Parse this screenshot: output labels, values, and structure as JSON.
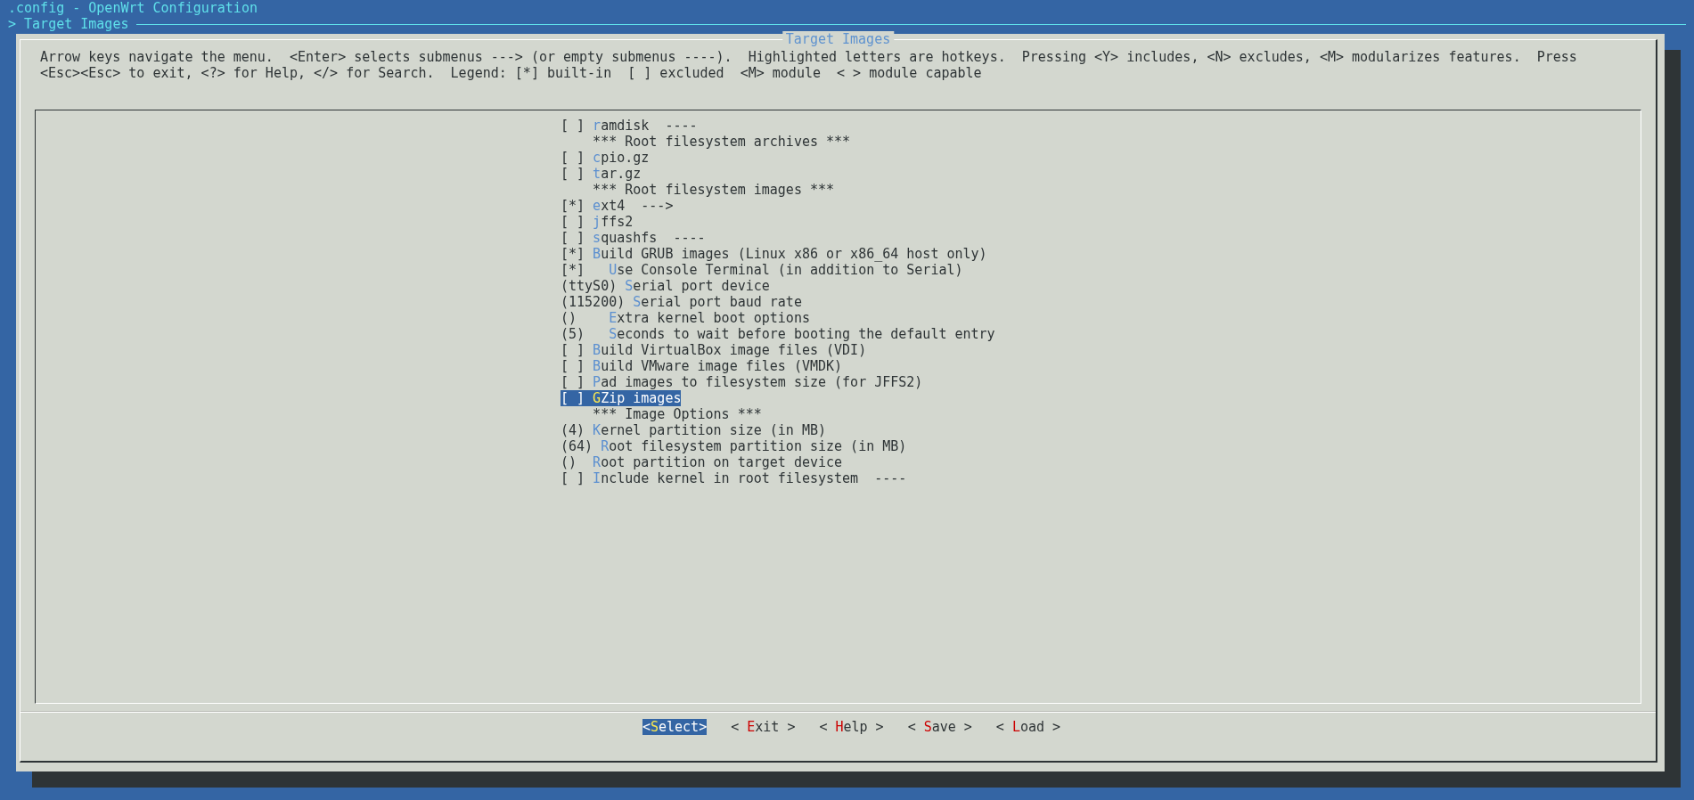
{
  "window": {
    "title": ".config - OpenWrt Configuration"
  },
  "breadcrumb": "> Target Images",
  "dialog": {
    "title": "Target Images",
    "help": [
      "Arrow keys navigate the menu.  <Enter> selects submenus ---> (or empty submenus ----).  Highlighted letters are hotkeys.  Pressing <Y> includes, <N> excludes, <M> modularizes features.  Press",
      "<Esc><Esc> to exit, <?> for Help, </> for Search.  Legend: [*] built-in  [ ] excluded  <M> module  < > module capable"
    ],
    "menu": [
      {
        "kind": "option",
        "prefix": "[ ]",
        "hotkey": "r",
        "label": "amdisk  ----",
        "selected": false
      },
      {
        "kind": "comment",
        "label": "*** Root filesystem archives ***",
        "selected": false
      },
      {
        "kind": "option",
        "prefix": "[ ]",
        "hotkey": "c",
        "label": "pio.gz",
        "selected": false
      },
      {
        "kind": "option",
        "prefix": "[ ]",
        "hotkey": "t",
        "label": "ar.gz",
        "selected": false
      },
      {
        "kind": "comment",
        "label": "*** Root filesystem images ***",
        "selected": false
      },
      {
        "kind": "option",
        "prefix": "[*]",
        "hotkey": "e",
        "label": "xt4  --->",
        "selected": false
      },
      {
        "kind": "option",
        "prefix": "[ ]",
        "hotkey": "j",
        "label": "ffs2",
        "selected": false
      },
      {
        "kind": "option",
        "prefix": "[ ]",
        "hotkey": "s",
        "label": "quashfs  ----",
        "selected": false
      },
      {
        "kind": "option",
        "prefix": "[*]",
        "hotkey": "B",
        "label": "uild GRUB images (Linux x86 or x86_64 host only)",
        "selected": false,
        "children": [
          {
            "kind": "option",
            "prefix": "[*]",
            "hotkey": "U",
            "label": "se Console Terminal (in addition to Serial)",
            "selected": false
          },
          {
            "kind": "option",
            "prefix": "(ttyS0)",
            "hotkey": "S",
            "label": "erial port device",
            "selected": false
          },
          {
            "kind": "option",
            "prefix": "(115200)",
            "hotkey": "S",
            "label": "erial port baud rate",
            "selected": false
          },
          {
            "kind": "option",
            "prefix": "()",
            "hotkey": "E",
            "label": "xtra kernel boot options",
            "selected": false
          },
          {
            "kind": "option",
            "prefix": "(5)",
            "hotkey": "S",
            "label": "econds to wait before booting the default entry",
            "selected": false
          }
        ]
      },
      {
        "kind": "option",
        "prefix": "[ ]",
        "hotkey": "B",
        "label": "uild VirtualBox image files (VDI)",
        "selected": false
      },
      {
        "kind": "option",
        "prefix": "[ ]",
        "hotkey": "B",
        "label": "uild VMware image files (VMDK)",
        "selected": false
      },
      {
        "kind": "option",
        "prefix": "[ ]",
        "hotkey": "P",
        "label": "ad images to filesystem size (for JFFS2)",
        "selected": false
      },
      {
        "kind": "option",
        "prefix": "[ ]",
        "hotkey": "G",
        "label": "Zip images",
        "selected": true
      },
      {
        "kind": "comment",
        "label": "*** Image Options ***",
        "selected": false
      },
      {
        "kind": "option",
        "prefix": "(4)",
        "hotkey": "K",
        "label": "ernel partition size (in MB)",
        "selected": false
      },
      {
        "kind": "option",
        "prefix": "(64)",
        "hotkey": "R",
        "label": "oot filesystem partition size (in MB)",
        "selected": false
      },
      {
        "kind": "option",
        "prefix": "()",
        "hotkey": "R",
        "label": "oot partition on target device",
        "selected": false
      },
      {
        "kind": "option",
        "prefix": "[ ]",
        "hotkey": "I",
        "label": "nclude kernel in root filesystem  ----",
        "selected": false
      }
    ],
    "buttons": [
      {
        "left": "<",
        "hotkey": "S",
        "label": "elect",
        "right": ">",
        "selected": true
      },
      {
        "left": "<",
        "hotkey": "E",
        "label": "xit",
        "right": ">",
        "selected": false
      },
      {
        "left": "<",
        "hotkey": "H",
        "label": "elp",
        "right": ">",
        "selected": false
      },
      {
        "left": "<",
        "hotkey": "S",
        "label": "ave",
        "right": ">",
        "selected": false
      },
      {
        "left": "<",
        "hotkey": "L",
        "label": "oad",
        "right": ">",
        "selected": false
      }
    ]
  }
}
